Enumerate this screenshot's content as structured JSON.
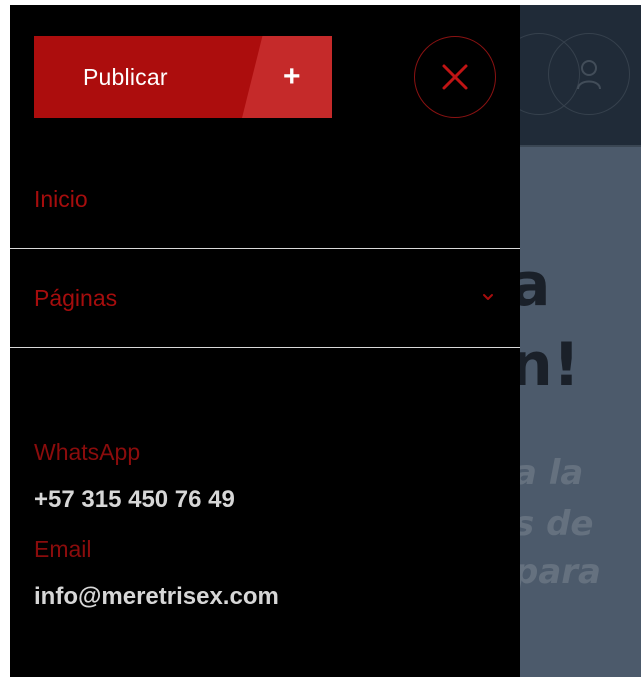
{
  "drawer": {
    "publish_label": "Publicar",
    "publish_icon": "+",
    "close_icon": "close-icon",
    "menu": [
      {
        "label": "Inicio"
      },
      {
        "label": "Páginas",
        "has_submenu": true
      }
    ],
    "contact": {
      "whatsapp_label": "WhatsApp",
      "whatsapp_value": "+57 315 450 76 49",
      "email_label": "Email",
      "email_value": "info@meretrisex.com"
    }
  },
  "background_page": {
    "heading_line_1": "a",
    "heading_line_2": "n!",
    "text_line_1": "a la",
    "text_line_2": "s de",
    "text_line_3": "para"
  },
  "colors": {
    "accent_red": "#ac0d0d",
    "accent_red_light": "#c52a2a",
    "drawer_bg": "#000000",
    "overlay_bg": "#4c5a6b"
  }
}
